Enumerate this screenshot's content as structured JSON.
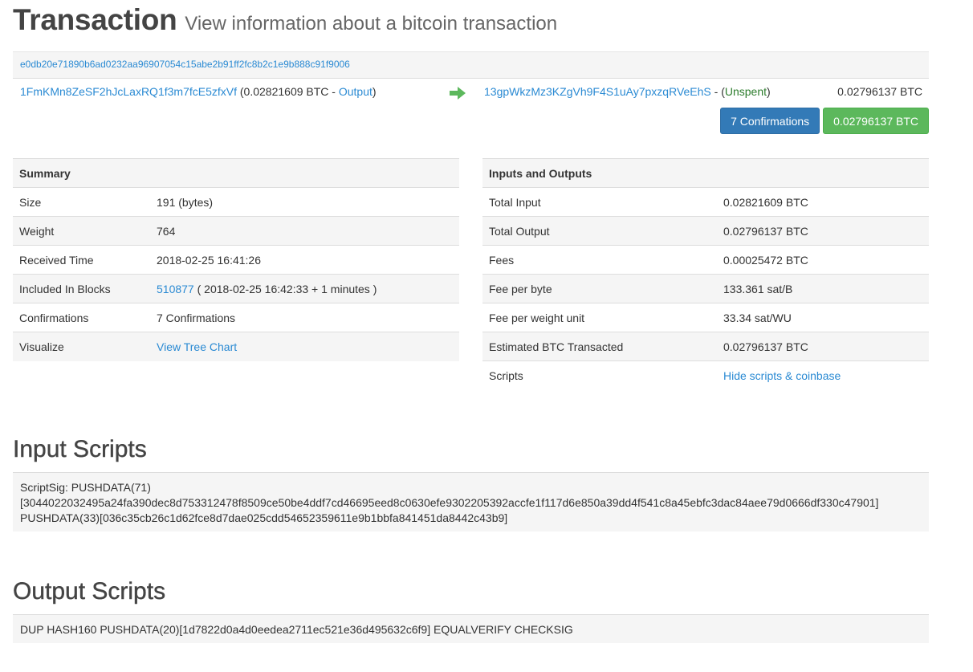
{
  "header": {
    "title": "Transaction",
    "subtitle": "View information about a bitcoin transaction"
  },
  "tx": {
    "hash": "e0db20e71890b6ad0232aa96907054c15abe2b91ff2fc8b2c1e9b888c91f9006",
    "input_address": "1FmKMn8ZeSF2hJcLaxRQ1f3m7fcE5zfxVf",
    "input_amount_pre": "(0.02821609 BTC - ",
    "input_output_link": "Output",
    "input_amount_post": ")",
    "output_address": "13gpWkzMz3KZgVh9F4S1uAy7pxzqRVeEhS",
    "output_sep": " - (",
    "output_status": "Unspent",
    "output_close": ")",
    "output_value": "0.02796137 BTC",
    "arrow_icon": "right-arrow-icon",
    "arrow_color": "#5cb85c"
  },
  "badges": {
    "confirmations": "7 Confirmations",
    "total": "0.02796137 BTC",
    "blue": "#337ab7",
    "green": "#5cb85c"
  },
  "summary": {
    "heading": "Summary",
    "rows": {
      "size": {
        "label": "Size",
        "value": "191 (bytes)"
      },
      "weight": {
        "label": "Weight",
        "value": "764"
      },
      "received": {
        "label": "Received Time",
        "value": "2018-02-25 16:41:26"
      },
      "included": {
        "label": "Included In Blocks",
        "block": "510877",
        "detail": " ( 2018-02-25 16:42:33 + 1 minutes )"
      },
      "confirmations": {
        "label": "Confirmations",
        "value": "7 Confirmations"
      },
      "visualize": {
        "label": "Visualize",
        "link": "View Tree Chart"
      }
    }
  },
  "inputs_outputs": {
    "heading": "Inputs and Outputs",
    "rows": {
      "total_input": {
        "label": "Total Input",
        "value": "0.02821609 BTC"
      },
      "total_output": {
        "label": "Total Output",
        "value": "0.02796137 BTC"
      },
      "fees": {
        "label": "Fees",
        "value": "0.00025472 BTC"
      },
      "fee_byte": {
        "label": "Fee per byte",
        "value": "133.361 sat/B"
      },
      "fee_weight": {
        "label": "Fee per weight unit",
        "value": "33.34 sat/WU"
      },
      "estimated": {
        "label": "Estimated BTC Transacted",
        "value": "0.02796137 BTC"
      },
      "scripts": {
        "label": "Scripts",
        "link": "Hide scripts & coinbase"
      }
    }
  },
  "input_scripts": {
    "heading": "Input Scripts",
    "line1": "ScriptSig: PUSHDATA(71)",
    "line2": "[3044022032495a24fa390dec8d753312478f8509ce50be4ddf7cd46695eed8c0630efe9302205392accfe1f117d6e850a39dd4f541c8a45ebfc3dac84aee79d0666df330c47901]",
    "line3": "PUSHDATA(33)[036c35cb26c1d62fce8d7dae025cdd54652359611e9b1bbfa841451da8442c43b9]"
  },
  "output_scripts": {
    "heading": "Output Scripts",
    "line1": "DUP HASH160 PUSHDATA(20)[1d7822d0a4d0eedea2711ec521e36d495632c6f9] EQUALVERIFY CHECKSIG"
  }
}
